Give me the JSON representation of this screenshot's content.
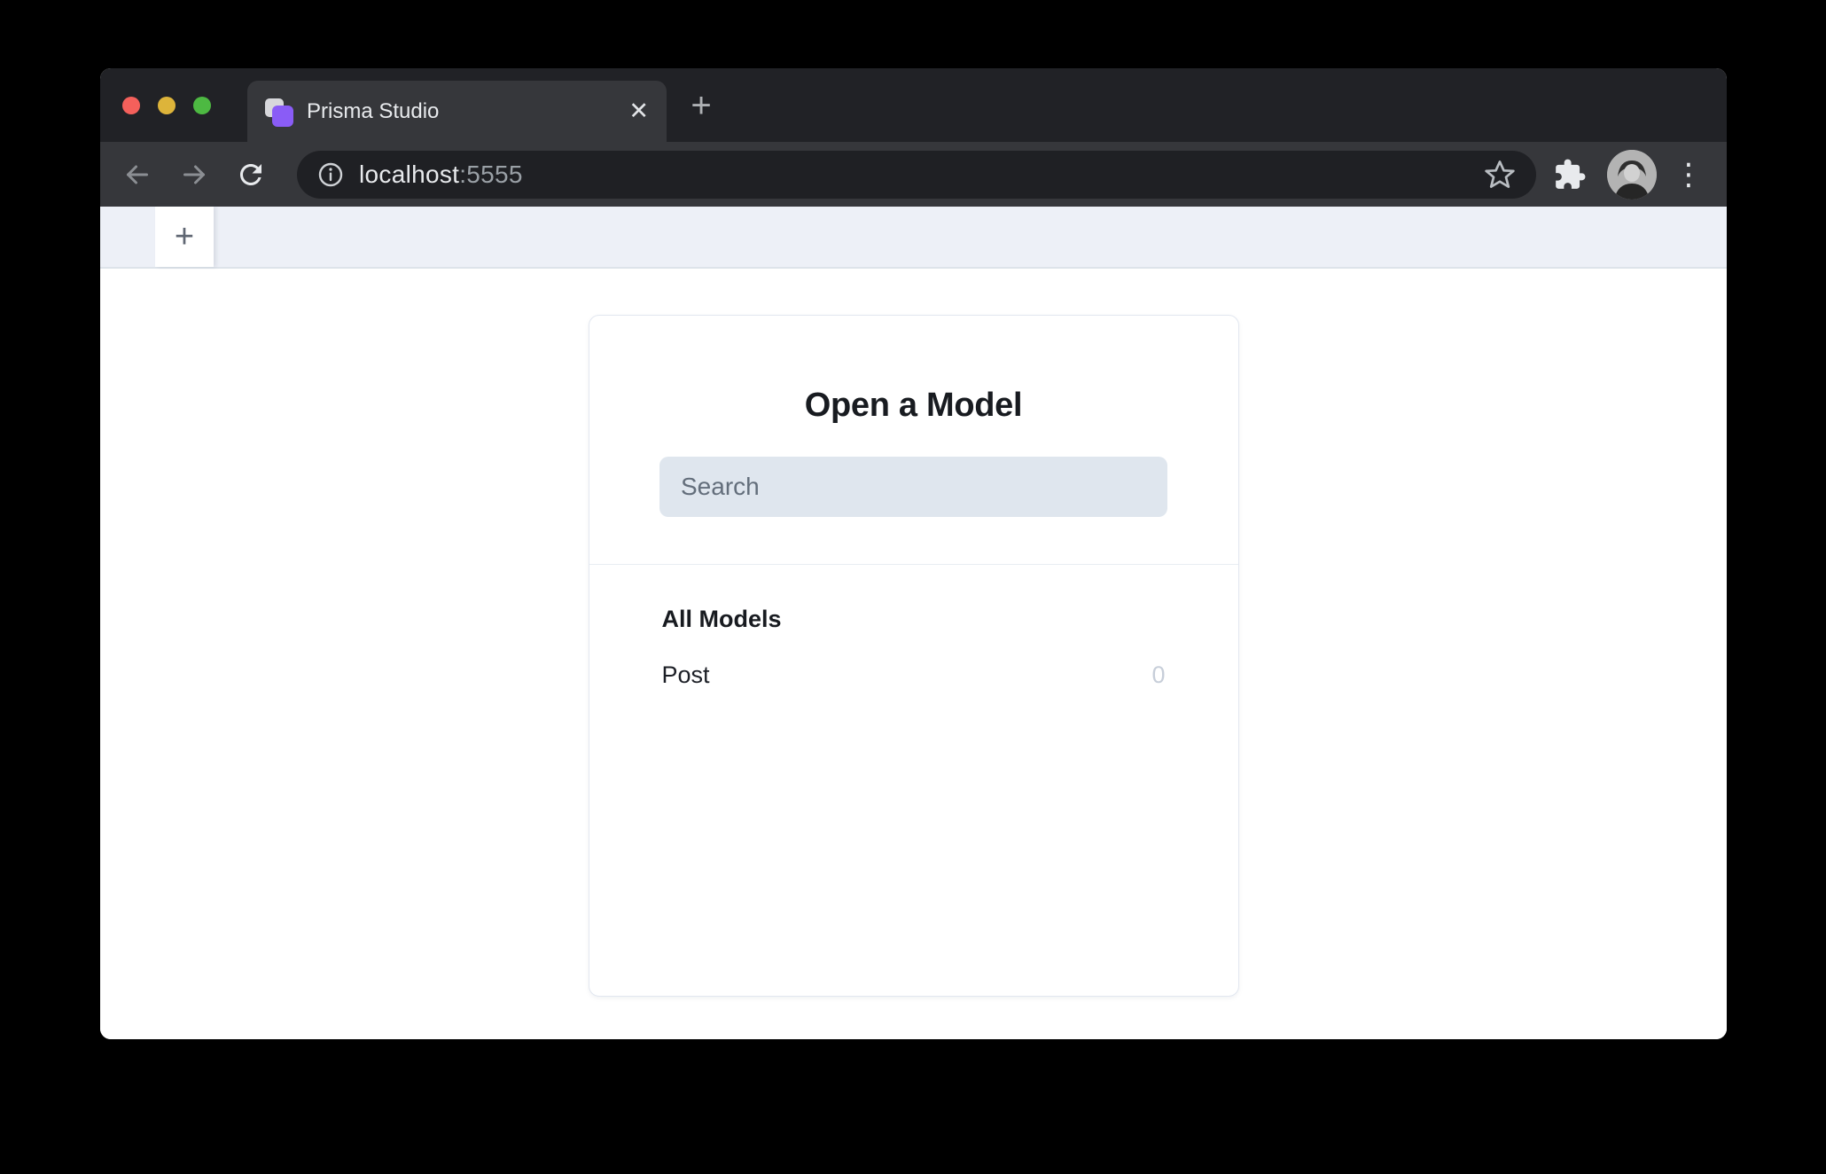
{
  "browser": {
    "tab": {
      "title": "Prisma Studio"
    },
    "url": {
      "host": "localhost",
      "port": ":5555"
    }
  },
  "app": {
    "heading": "Open a Model",
    "search": {
      "placeholder": "Search"
    },
    "models": {
      "section_title": "All Models",
      "items": [
        {
          "name": "Post",
          "count": "0"
        }
      ]
    }
  },
  "icons": {
    "close": "✕",
    "plus": "+",
    "kebab": "⋮",
    "back": "back-arrow-icon",
    "forward": "forward-arrow-icon",
    "reload": "reload-icon",
    "site_info": "info-circle-icon",
    "bookmark": "star-outline-icon",
    "extensions": "puzzle-piece-icon",
    "menu": "kebab-menu-icon",
    "favicon": "prisma-logo-icon"
  },
  "colors": {
    "chrome_tabbar": "#212226",
    "chrome_surface": "#36373b",
    "omnibox_bg": "#1f2024",
    "chrome_text": "#e8eaed",
    "chrome_muted": "#9aa0a6",
    "traffic_red": "#f4605b",
    "traffic_yellow": "#ddb43a",
    "traffic_green": "#4db942",
    "prisma_purple": "#8a5cf6",
    "favicon_back": "#d7d7db",
    "strip_bg": "#edf0f7",
    "strip_border": "#dde3ea",
    "strip_plus": "#5f6672",
    "card_border": "#e2e7f0",
    "divider": "#e9edf3",
    "heading": "#181b20",
    "text_dark": "#1c1f26",
    "search_bg": "#dfe6ee",
    "search_placeholder": "#636e7b",
    "count_muted": "#c7ced9"
  }
}
